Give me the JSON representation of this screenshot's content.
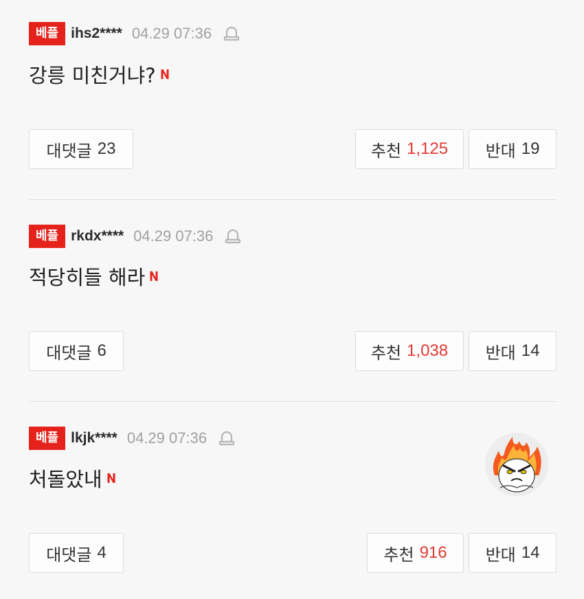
{
  "comments": [
    {
      "badge": "베플",
      "username": "ihs2****",
      "timestamp": "04.29 07:36",
      "text": "강릉 미친거냐?",
      "replies_label": "대댓글",
      "replies_count": "23",
      "upvote_label": "추천",
      "upvote_count": "1,125",
      "downvote_label": "반대",
      "downvote_count": "19"
    },
    {
      "badge": "베플",
      "username": "rkdx****",
      "timestamp": "04.29 07:36",
      "text": "적당히들 해라",
      "replies_label": "대댓글",
      "replies_count": "6",
      "upvote_label": "추천",
      "upvote_count": "1,038",
      "downvote_label": "반대",
      "downvote_count": "14"
    },
    {
      "badge": "베플",
      "username": "lkjk****",
      "timestamp": "04.29 07:36",
      "text": "처돌았내",
      "replies_label": "대댓글",
      "replies_count": "4",
      "upvote_label": "추천",
      "upvote_count": "916",
      "downvote_label": "반대",
      "downvote_count": "14"
    }
  ],
  "colors": {
    "badge_bg": "#e5231c",
    "upvote_count": "#e23a34",
    "new_mark": "#e5231c"
  },
  "icons": {
    "report": "bell-icon",
    "new": "new-n-icon",
    "avatar": "flame-avatar-icon"
  }
}
